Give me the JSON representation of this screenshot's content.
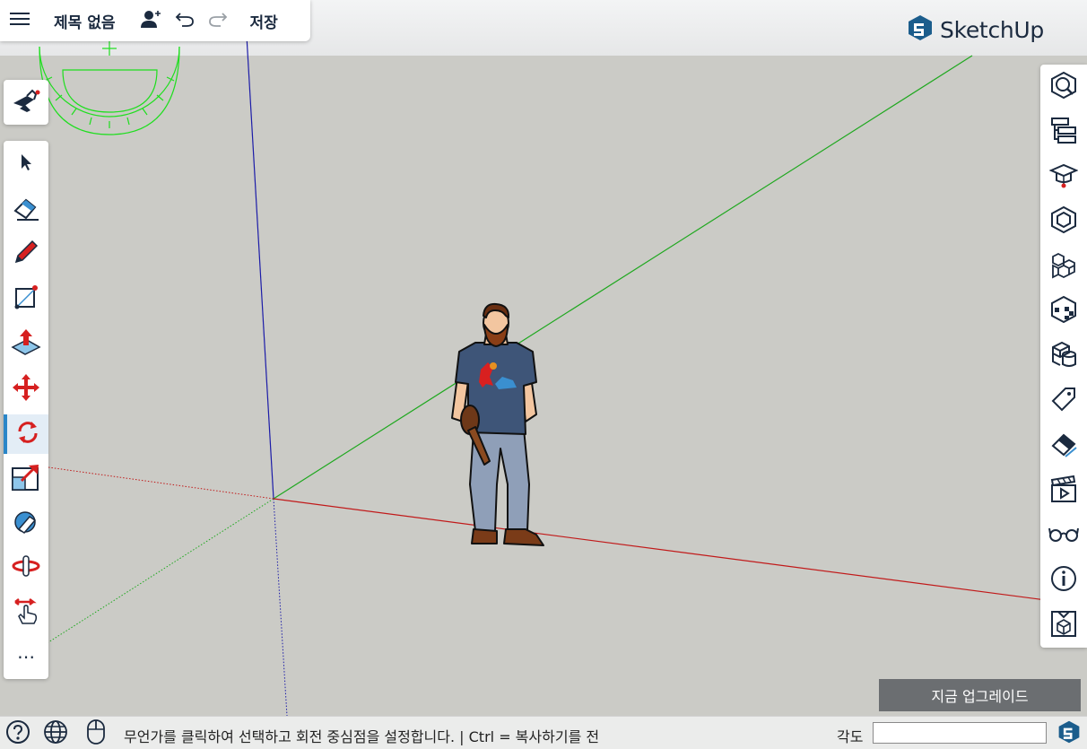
{
  "app": {
    "document_title": "제목 없음",
    "save_label": "저장",
    "logo_text": "SketchUp",
    "brand_color": "#1b5d8c"
  },
  "topbar": {
    "icons": [
      "menu-icon",
      "add-user-icon",
      "undo-icon",
      "redo-icon"
    ]
  },
  "left_toolbar": {
    "tools": [
      {
        "name": "select-tool",
        "icon": "arrow-icon"
      },
      {
        "name": "eraser-tool",
        "icon": "eraser-icon"
      },
      {
        "name": "pencil-tool",
        "icon": "pencil-icon"
      },
      {
        "name": "shape-tool",
        "icon": "rectangle-icon"
      },
      {
        "name": "push-pull-tool",
        "icon": "push-pull-icon"
      },
      {
        "name": "move-tool",
        "icon": "move-icon"
      },
      {
        "name": "rotate-tool",
        "icon": "rotate-icon",
        "active": true
      },
      {
        "name": "scale-tool",
        "icon": "scale-icon"
      },
      {
        "name": "tape-measure-tool",
        "icon": "tape-measure-icon"
      },
      {
        "name": "orbit-tool",
        "icon": "orbit-icon"
      },
      {
        "name": "pan-tool",
        "icon": "pan-hand-icon"
      },
      {
        "name": "more-tools",
        "icon": "more-icon",
        "label": "⋯"
      }
    ]
  },
  "right_toolbar": {
    "panels": [
      "entity-info-icon",
      "outliner-icon",
      "instructor-icon",
      "components-icon",
      "materials-icon",
      "styles-icon",
      "solid-tools-icon",
      "tags-icon",
      "eraser-soften-icon",
      "scenes-icon",
      "display-icon",
      "info-icon",
      "3d-warehouse-icon"
    ]
  },
  "upgrade_label": "지금 업그레이드",
  "statusbar": {
    "message": "무언가를 클릭하여 선택하고 회전 중심점을 설정합니다. | Ctrl = 복사하기를 전",
    "angle_label": "각도",
    "angle_value": ""
  },
  "colors": {
    "axis_red": "#c11a1a",
    "axis_green": "#1fa81f",
    "axis_blue": "#1c1ca8",
    "protractor": "#1ede1e",
    "active_tool": "#2a86c8"
  }
}
